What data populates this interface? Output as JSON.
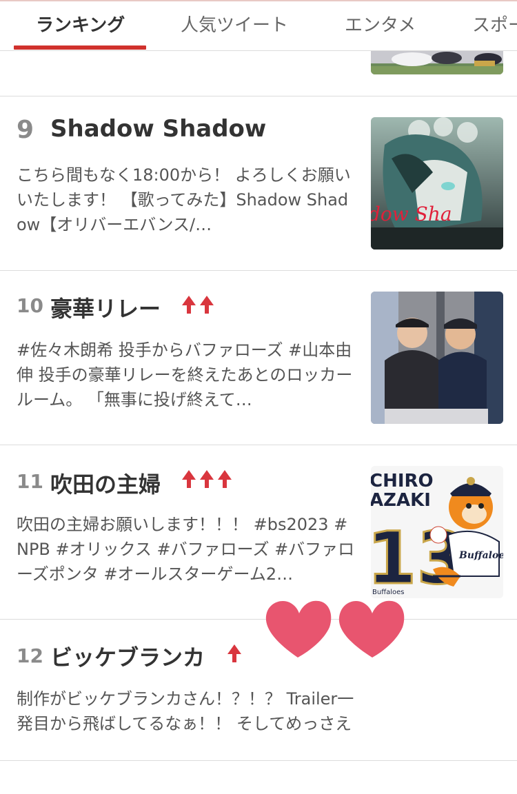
{
  "tabs": [
    {
      "label": "ランキング",
      "active": true
    },
    {
      "label": "人気ツイート",
      "active": false
    },
    {
      "label": "エンタメ",
      "active": false
    },
    {
      "label": "スポー",
      "active": false
    }
  ],
  "items": [
    {
      "rank": "9",
      "title": "Shadow Shadow",
      "trend_arrows": 0,
      "description": "こちら間もなく18:00から！ よろしくお願いいたします！ 【歌ってみた】Shadow Shadow【オリバーエバンス/…"
    },
    {
      "rank": "10",
      "title": "豪華リレー",
      "trend_arrows": 2,
      "description": "#佐々木朗希 投手からバファローズ #山本由伸 投手の豪華リレーを終えたあとのロッカールーム。 「無事に投げ終えて…"
    },
    {
      "rank": "11",
      "title": "吹田の主婦",
      "trend_arrows": 3,
      "description": "吹田の主婦お願いします！！！ #bs2023 #NPB #オリックス #バファローズ #バファローズポンタ #オールスターゲーム2…"
    },
    {
      "rank": "12",
      "title": "ビッケブランカ",
      "trend_arrows": 1,
      "description": "制作がビッケブランカさん！？！？ Trailer一発目から飛ばしてるなぁ！！ そしてめっさええ！！ それぞれ楽しみや…"
    }
  ],
  "thumb_text": {
    "shadow": "dow Sha",
    "chiro": "CHIRO",
    "azaki": "AZAKI",
    "num": "13",
    "buffaloes": "Buffaloes",
    "buffaloes_small": "Buffaloes"
  },
  "colors": {
    "accent": "#d0312d",
    "arrow": "#d9363e",
    "heart": "#e8556f"
  }
}
